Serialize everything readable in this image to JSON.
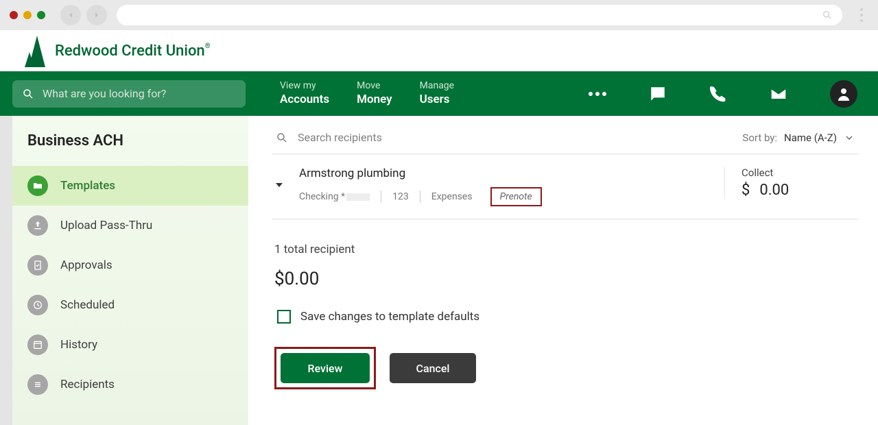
{
  "browser": {
    "search_icon": "search"
  },
  "logo": {
    "text": "Redwood Credit Union"
  },
  "topnav": {
    "search_placeholder": "What are you looking for?",
    "items": [
      {
        "top": "View my",
        "bottom": "Accounts"
      },
      {
        "top": "Move",
        "bottom": "Money"
      },
      {
        "top": "Manage",
        "bottom": "Users"
      }
    ]
  },
  "sidebar": {
    "title": "Business ACH",
    "items": [
      {
        "label": "Templates",
        "active": true
      },
      {
        "label": "Upload Pass-Thru",
        "active": false
      },
      {
        "label": "Approvals",
        "active": false
      },
      {
        "label": "Scheduled",
        "active": false
      },
      {
        "label": "History",
        "active": false
      },
      {
        "label": "Recipients",
        "active": false
      }
    ]
  },
  "search": {
    "placeholder": "Search recipients",
    "sort_label": "Sort by:",
    "sort_value": "Name (A-Z)"
  },
  "recipient": {
    "name": "Armstrong plumbing",
    "account_type": "Checking *",
    "code": "123",
    "category": "Expenses",
    "flag": "Prenote",
    "collect_label": "Collect",
    "collect_currency": "$",
    "collect_amount": "0.00"
  },
  "totals": {
    "count_line": "1 total recipient",
    "amount": "$0.00"
  },
  "save_defaults_label": "Save changes to template defaults",
  "buttons": {
    "review": "Review",
    "cancel": "Cancel"
  }
}
